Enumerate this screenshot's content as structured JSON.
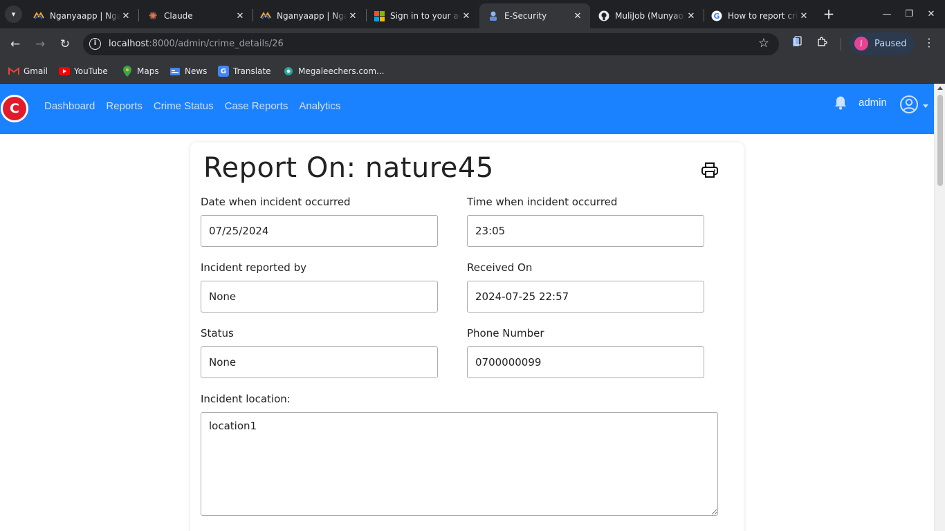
{
  "browser": {
    "tabs": [
      {
        "title": "Nganyaapp | Nganyaapp",
        "icon": "nganya-favicon-icon",
        "active": false
      },
      {
        "title": "Claude",
        "icon": "claude-favicon-icon",
        "active": false
      },
      {
        "title": "Nganyaapp | Nganyaapp",
        "icon": "nganya-favicon-icon",
        "active": false
      },
      {
        "title": "Sign in to your account",
        "icon": "microsoft-favicon-icon",
        "active": false
      },
      {
        "title": "E-Security",
        "icon": "esecurity-favicon-icon",
        "active": true
      },
      {
        "title": "MuliJob (Munyao)",
        "icon": "github-favicon-icon",
        "active": false
      },
      {
        "title": "How to report crime",
        "icon": "google-favicon-icon",
        "active": false
      }
    ],
    "url_host": "localhost",
    "url_path": ":8000/admin/crime_details/26",
    "profile_initial": "J",
    "profile_label": "Paused",
    "bookmarks": [
      {
        "label": "Gmail",
        "icon": "gmail-icon",
        "color": "#ea4335"
      },
      {
        "label": "YouTube",
        "icon": "youtube-icon",
        "color": "#ff0000"
      },
      {
        "label": "Maps",
        "icon": "maps-pin-icon",
        "color": "#34a853"
      },
      {
        "label": "News",
        "icon": "news-icon",
        "color": "#4285f4"
      },
      {
        "label": "Translate",
        "icon": "translate-icon",
        "color": "#4285f4"
      },
      {
        "label": "Megaleechers.com...",
        "icon": "megaleechers-icon",
        "color": "#26a69a"
      }
    ]
  },
  "app": {
    "brand_color": "#1a82ff",
    "logo_letter": "C",
    "nav": [
      "Dashboard",
      "Reports",
      "Crime Status",
      "Case Reports",
      "Analytics"
    ],
    "user_name": "admin"
  },
  "report": {
    "title": "Report On: nature45",
    "fields": {
      "date_label": "Date when incident occurred",
      "date_value": "07/25/2024",
      "time_label": "Time when incident occurred",
      "time_value": "23:05",
      "reported_by_label": "Incident reported by",
      "reported_by_value": "None",
      "received_label": "Received On",
      "received_value": "2024-07-25 22:57",
      "status_label": "Status",
      "status_value": "None",
      "phone_label": "Phone Number",
      "phone_value": "0700000099",
      "location_label": "Incident location:",
      "location_value": "location1"
    }
  }
}
